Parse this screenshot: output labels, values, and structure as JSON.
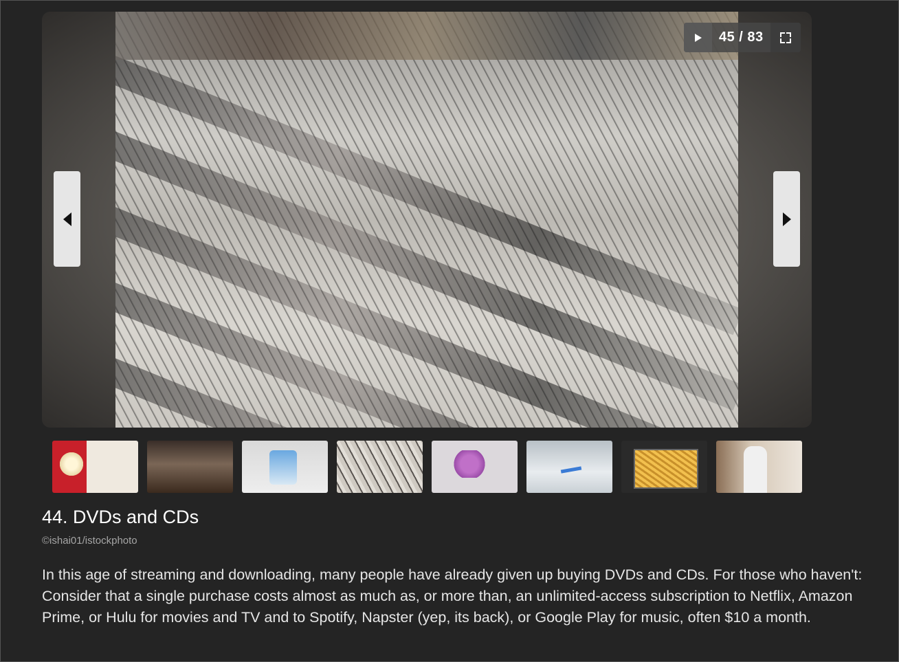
{
  "slideshow": {
    "counter": "45 / 83",
    "play_icon": "play-icon",
    "fullscreen_icon": "fullscreen-icon",
    "prev_icon": "chevron-left-icon",
    "next_icon": "chevron-right-icon",
    "thumbnails": [
      "popcorn",
      "figurines",
      "water-filter",
      "dvd-cases",
      "toy",
      "razor",
      "fries",
      "man-reading"
    ]
  },
  "slide": {
    "title": "44. DVDs and CDs",
    "credit": "©ishai01/istockphoto",
    "description": "In this age of streaming and downloading, many people have already given up buying DVDs and CDs. For those who haven't: Consider that a single purchase costs almost as much as, or more than, an unlimited-access subscription to Netflix, Amazon Prime, or Hulu for movies and TV and to Spotify, Napster (yep, its back), or Google Play for music, often $10 a month."
  },
  "colors": {
    "background": "#242424",
    "nav_button": "#e6e6e6"
  }
}
